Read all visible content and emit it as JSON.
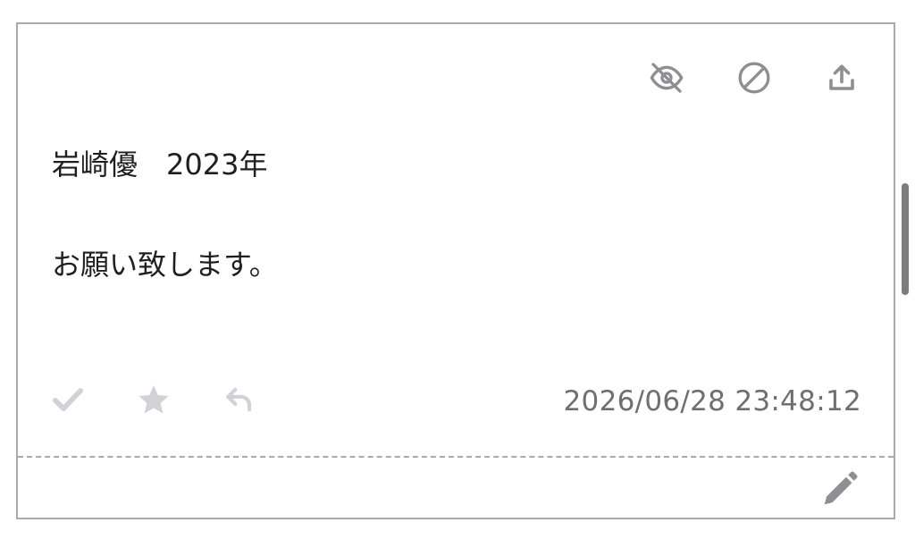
{
  "message": {
    "line1": "岩崎優　2023年",
    "line2": "お願い致します。",
    "timestamp": "2026/06/28 23:48:12"
  },
  "icons": {
    "hide": "eye-off-icon",
    "block": "block-icon",
    "share": "upload-icon",
    "check": "check-icon",
    "star": "star-icon",
    "reply": "reply-icon",
    "edit": "pencil-icon"
  },
  "colors": {
    "icon_gray": "#8e8e93",
    "action_inactive": "#d1d1d6",
    "text": "#1f1f1f",
    "timestamp": "#6e6e73",
    "border": "#a9a9ae"
  }
}
